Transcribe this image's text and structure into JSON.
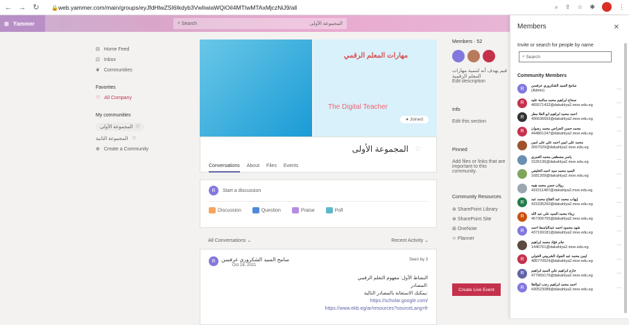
{
  "browser": {
    "url": "web.yammer.com/main/groups/eyJfdHlwZSI6Ikdyb3VwIiwiaWQiOiI4MTIwMTAxMjczNiJ9/all"
  },
  "suite": {
    "app": "Yammer",
    "search_placeholder": "Search",
    "search_group": "المجموعة الأولى"
  },
  "left": {
    "home": "Home Feed",
    "inbox": "Inbox",
    "communities": "Communities",
    "favorites": "Favorites",
    "all_company": "All Company",
    "my_communities": "My communities",
    "g1": "المجموعة الأولى",
    "g2": "المجموعة الثانية",
    "create": "Create a Community"
  },
  "cover": {
    "title": "مهارات المعلم الرقمي",
    "subtitle": "The Digital Teacher",
    "joined": "Joined"
  },
  "group": {
    "name": "المجموعة الأولى",
    "tabs": [
      "Conversations",
      "About",
      "Files",
      "Events"
    ]
  },
  "post": {
    "start": "Start a discussion",
    "types": [
      "Discussion",
      "Question",
      "Praise",
      "Poll"
    ]
  },
  "feed": {
    "filter": "All Conversations",
    "sort": "Recent Activity"
  },
  "message": {
    "author": "سامح السيد الشكروري عرفسن",
    "date": "Oct 18, 2021",
    "seen": "Seen by 3",
    "lines": [
      "النشاط الأول: مفهوم التعلم الرقمي",
      "المصادر:",
      "يمكنك الاستعانة بالمصادر التالية:"
    ],
    "link1": "https://scholar.google.com/",
    "link2": "https://www.ekb.eg/ar/resources?sourceLang=fr"
  },
  "right": {
    "members_label": "Members",
    "members_count": "52",
    "desc": "فيم يهدف أنه لتنمية مهارات المعلم الرقمية",
    "edit_desc": "Edit description",
    "info": "Info",
    "edit_section": "Edit this section",
    "pinned": "Pinned",
    "pinned_text": "Add files or links that are important to this community.",
    "resources": "Community Resources",
    "res": [
      "SharePoint Library",
      "SharePoint Site",
      "OneNote",
      "Planner"
    ],
    "live": "Create Live Event"
  },
  "panel": {
    "title": "Members",
    "invite": "Invite or search for people by name",
    "search": "Search",
    "section": "Community Members",
    "members": [
      {
        "name": "سامح السيد الشكروري عرفسن",
        "sub": "(Admin)",
        "color": "#8378de",
        "img": false
      },
      {
        "name": "صحاح ابراهيم محمد سالمة عليه",
        "sub": "465571432@dakahlya2.moe.edu.eg",
        "color": "#c4314b",
        "img": false
      },
      {
        "name": "احمد محمد ابراهيم ابو العلا مطر",
        "sub": "490636693@dakahlya2.moe.edu.eg",
        "color": "#333333",
        "img": false
      },
      {
        "name": "محمد حسن الجزاجي محمد رضوان",
        "sub": "444801247@dakahlya2.moe.edu.eg",
        "color": "#c4314b",
        "img": false
      },
      {
        "name": "محمد علي امين احمد علي على امين",
        "sub": "2657029@dakahlya2.moe.edu.eg",
        "color": "#a0522d",
        "img": true
      },
      {
        "name": "ياسر مصطفى محمد الغمري",
        "sub": "1526136@dakahlya2.moe.edu.eg",
        "color": "#6b8fb3",
        "img": true
      },
      {
        "name": "السيد محمد سيد احمد الخليفي",
        "sub": "1681209@dakahlya2.moe.edu.eg",
        "color": "#7fa65b",
        "img": true
      },
      {
        "name": "رولان حسن محمد هيبه",
        "sub": "431511487@dakahlya2.moe.edu.eg",
        "color": "#9aa6b0",
        "img": true
      },
      {
        "name": "إيهاب محمد عبد الفتاح محمد عبد",
        "sub": "415335260@dakahlya2.moe.edu.eg",
        "color": "#237b4b",
        "img": false
      },
      {
        "name": "زيناء محمد السيد على عبد الله",
        "sub": "457306755@dakahlya2.moe.edu.eg",
        "color": "#ca5010",
        "img": false
      },
      {
        "name": "شهد محمود احمد عبدالباسط احمد",
        "sub": "437169181@dakahlya2.moe.edu.eg",
        "color": "#8378de",
        "img": false
      },
      {
        "name": "جانر فؤاد محمد ابراهيم",
        "sub": "1446761@dakahlya2.moe.edu.eg",
        "color": "#5b4a3f",
        "img": true
      },
      {
        "name": "ايمن محمد عبد الجواد الشربيني الخولي",
        "sub": "485770524@dakahlya2.moe.edu.eg",
        "color": "#c4314b",
        "img": false
      },
      {
        "name": "حازم ابراهيم علي السيد ابراهيم",
        "sub": "477969176@dakahlya2.moe.edu.eg",
        "color": "#6264a7",
        "img": false
      },
      {
        "name": "احمد محمد ابراهيم رجب ابوالعلا",
        "sub": "430523088@dakahlya2.moe.edu.eg",
        "color": "#8378de",
        "img": false
      }
    ]
  }
}
